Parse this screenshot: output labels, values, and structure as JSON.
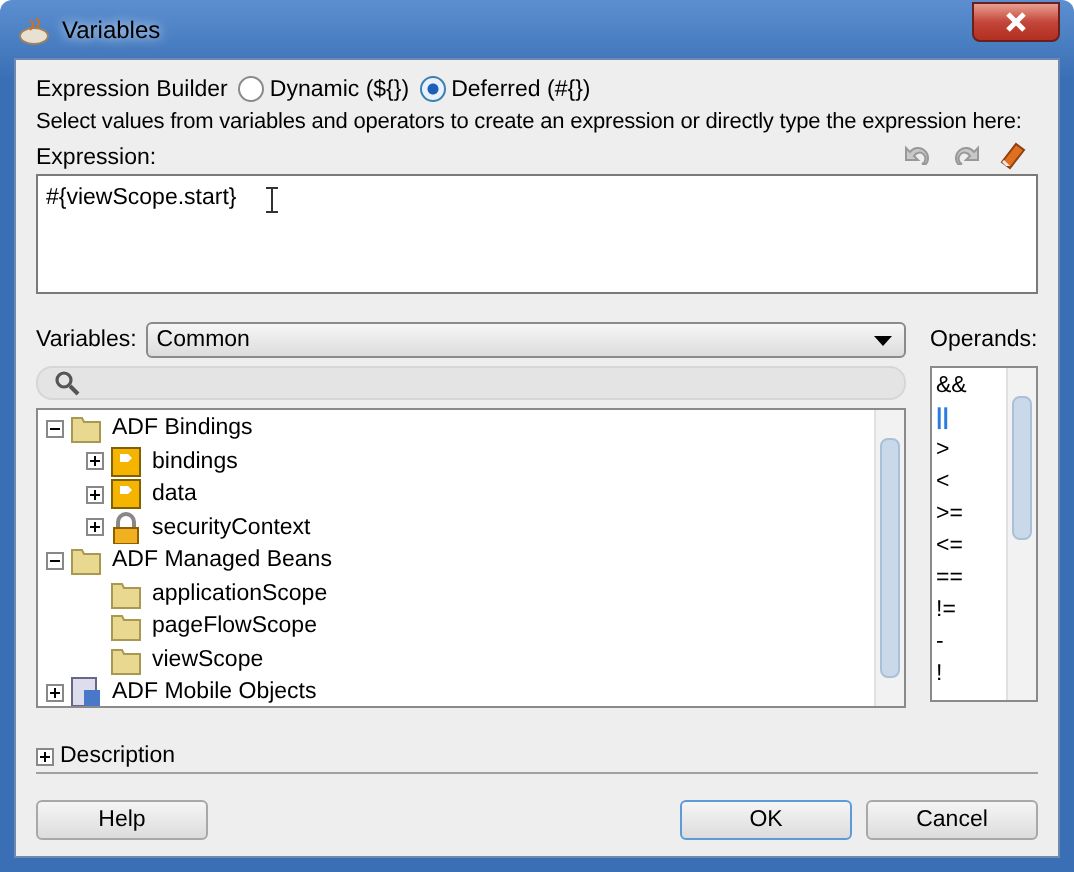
{
  "window": {
    "title": "Variables"
  },
  "mode": {
    "label": "Expression Builder",
    "options": [
      {
        "label": "Dynamic (${})",
        "selected": false
      },
      {
        "label": "Deferred (#{})",
        "selected": true
      }
    ]
  },
  "instructions": "Select values from variables and operators to create an expression or directly type the expression here:",
  "expression": {
    "label": "Expression:",
    "value": "#{viewScope.start}"
  },
  "variables": {
    "label": "Variables:",
    "value": "Common"
  },
  "tree": [
    {
      "label": "ADF Bindings",
      "kind": "folder",
      "expanded": true,
      "children": [
        {
          "label": "bindings",
          "kind": "binding",
          "expanded": false
        },
        {
          "label": "data",
          "kind": "binding",
          "expanded": false
        },
        {
          "label": "securityContext",
          "kind": "lock",
          "expanded": false
        }
      ]
    },
    {
      "label": "ADF Managed Beans",
      "kind": "folder",
      "expanded": true,
      "children": [
        {
          "label": "applicationScope",
          "kind": "folder"
        },
        {
          "label": "pageFlowScope",
          "kind": "folder"
        },
        {
          "label": "viewScope",
          "kind": "folder"
        }
      ]
    },
    {
      "label": "ADF Mobile Objects",
      "kind": "mobile",
      "expanded": false
    }
  ],
  "operands": {
    "label": "Operands:",
    "items": [
      {
        "label": "&&",
        "selected": false
      },
      {
        "label": "||",
        "selected": true
      },
      {
        "label": ">",
        "selected": false
      },
      {
        "label": "<",
        "selected": false
      },
      {
        "label": ">=",
        "selected": false
      },
      {
        "label": "<=",
        "selected": false
      },
      {
        "label": "==",
        "selected": false
      },
      {
        "label": "!=",
        "selected": false
      },
      {
        "label": "-",
        "selected": false
      },
      {
        "label": "!",
        "selected": false
      }
    ]
  },
  "description": {
    "label": "Description",
    "expanded": false
  },
  "buttons": [
    {
      "label": "Help",
      "kind": "left"
    },
    {
      "label": "OK",
      "kind": "default"
    },
    {
      "label": "Cancel",
      "kind": "plain"
    }
  ]
}
